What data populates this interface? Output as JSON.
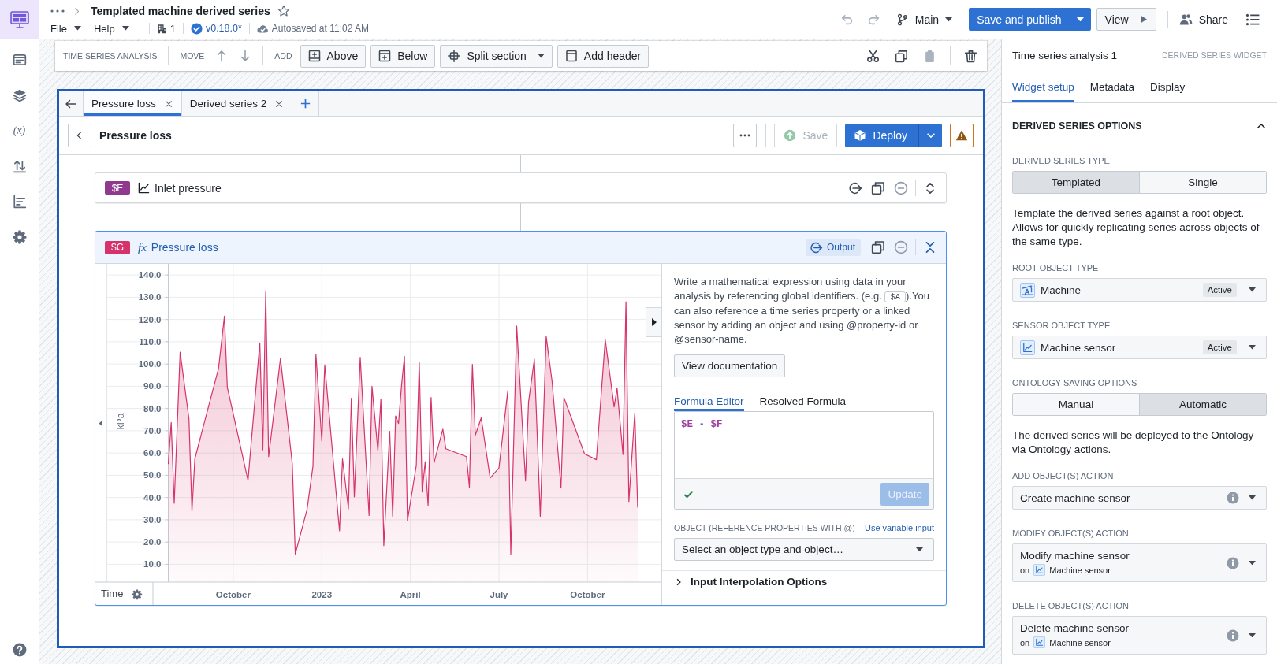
{
  "header": {
    "title": "Templated machine derived series",
    "starred": false,
    "menus": [
      "File",
      "Help"
    ],
    "collaborators": "1",
    "version": "v0.18.0*",
    "autosave": "Autosaved at 11:02 AM",
    "undo_disabled": true,
    "redo_disabled": true,
    "branch": "Main",
    "publish_button": "Save and publish",
    "view_button": "View",
    "share_button": "Share"
  },
  "rail": {
    "variables_label": "(x)"
  },
  "toolbar": {
    "title": "TIME SERIES ANALYSIS",
    "move_label": "MOVE",
    "add_label": "ADD",
    "add_buttons": [
      {
        "kind": "above",
        "label": "Above"
      },
      {
        "kind": "below",
        "label": "Below"
      },
      {
        "kind": "split",
        "label": "Split section"
      },
      {
        "kind": "header",
        "label": "Add header"
      }
    ],
    "paste_disabled": true
  },
  "widget": {
    "tabs": [
      {
        "label": "Pressure loss",
        "selected": true
      },
      {
        "label": "Derived series 2",
        "selected": false
      }
    ],
    "title": "Pressure loss",
    "save_button": {
      "label": "Save",
      "disabled": true
    },
    "deploy_button": "Deploy",
    "warning": true,
    "cards": [
      {
        "kind": "series",
        "badge": "$E",
        "color": "#8f398f",
        "name": "Inlet pressure",
        "selected": false,
        "expanded": false,
        "output": false
      },
      {
        "kind": "formula",
        "badge": "$G",
        "color": "#d6336c",
        "symbol": "fx",
        "name": "Pressure loss",
        "selected": true,
        "expanded": true,
        "output": true,
        "output_label": "Output",
        "chart_data": {
          "type": "area",
          "xlabel": "Time",
          "ylabel": "kPa",
          "grid": true,
          "categories": [
            null,
            null,
            null,
            null,
            null,
            null,
            null,
            null,
            null,
            null,
            null,
            null,
            null,
            null,
            null,
            null,
            null,
            null,
            null,
            null,
            null,
            null,
            "October",
            null,
            null,
            null,
            null,
            null,
            null,
            null,
            null,
            null,
            null,
            null,
            null,
            null,
            null,
            null,
            null,
            null,
            null,
            null,
            null,
            null,
            null,
            null,
            null,
            null,
            null,
            null,
            null,
            null,
            "2023",
            null,
            null,
            null,
            null,
            null,
            null,
            null,
            null,
            null,
            null,
            null,
            null,
            null,
            null,
            null,
            null,
            null,
            null,
            null,
            null,
            null,
            null,
            null,
            null,
            null,
            null,
            null,
            null,
            null,
            "April",
            null,
            null,
            null,
            null,
            null,
            null,
            null,
            null,
            null,
            null,
            null,
            null,
            null,
            null,
            null,
            null,
            null,
            null,
            null,
            null,
            null,
            null,
            null,
            null,
            null,
            null,
            null,
            null,
            null,
            "July",
            null,
            null,
            null,
            null,
            null,
            null,
            null,
            null,
            null,
            null,
            null,
            null,
            null,
            null,
            null,
            null,
            null,
            null,
            null,
            null,
            null,
            null,
            null,
            null,
            null,
            null,
            null,
            null,
            null,
            "October",
            null,
            null,
            null,
            null,
            null,
            null,
            null,
            null,
            null,
            null,
            null,
            null,
            null,
            null,
            null,
            null,
            null,
            null,
            null,
            null,
            null,
            null,
            null,
            null,
            null
          ],
          "series": [
            {
              "color": "#d6336c",
              "values": [
                55,
                73.7,
                37.4,
                null,
                105.3,
                null,
                null,
                75.4,
                33.9,
                57.4,
                null,
                null,
                null,
                null,
                null,
                null,
                null,
                98,
                null,
                121.5,
                89.5,
                null,
                null,
                null,
                null,
                null,
                null,
                47.7,
                null,
                null,
                null,
                109.5,
                61.4,
                132.4,
                58.4,
                null,
                null,
                null,
                102.5,
                null,
                null,
                null,
                55.3,
                14.6,
                null,
                null,
                null,
                34.6,
                null,
                54,
                104.3,
                null,
                65.4,
                99.6,
                null,
                null,
                null,
                null,
                25,
                57.4,
                null,
                35,
                84.6,
                40.3,
                null,
                103,
                null,
                null,
                31.9,
                90,
                null,
                61,
                84.2,
                18.4,
                null,
                69.8,
                31.2,
                76.7,
                73.3,
                90.4,
                103.4,
                29.5,
                null,
                null,
                54.4,
                100.8,
                42.5,
                56.1,
                36.5,
                85,
                55.6,
                null,
                null,
                70.7,
                61.9,
                null,
                null,
                null,
                null,
                null,
                null,
                58.4,
                44.6,
                99.8,
                68,
                null,
                75.8,
                null,
                null,
                48.8,
                null,
                null,
                53.3,
                null,
                null,
                88,
                14.6,
                null,
                117.1,
                null,
                null,
                47.4,
                82.8,
                null,
                102.1,
                null,
                31.6,
                null,
                112.4,
                null,
                92.1,
                null,
                null,
                44.4,
                84.9,
                null,
                null,
                null,
                null,
                null,
                null,
                59.6,
                null,
                null,
                null,
                57,
                null,
                null,
                111,
                null,
                null,
                80.7,
                89.1,
                null,
                59.3,
                128,
                38.2,
                null,
                78,
                35.4,
                null,
                null,
                null,
                null,
                null,
                null,
                null,
                null
              ]
            }
          ],
          "ylim": [
            2,
            145
          ],
          "yticks": [
            {
              "value": 10,
              "label": "10.0"
            },
            {
              "value": 20,
              "label": "20.0"
            },
            {
              "value": 30,
              "label": "30.0"
            },
            {
              "value": 40,
              "label": "40.0"
            },
            {
              "value": 50,
              "label": "50.0"
            },
            {
              "value": 60,
              "label": "60.0"
            },
            {
              "value": 70,
              "label": "70.0"
            },
            {
              "value": 80,
              "label": "80.0"
            },
            {
              "value": 90,
              "label": "90.0"
            },
            {
              "value": 100,
              "label": "100.0"
            },
            {
              "value": 110,
              "label": "110.0"
            },
            {
              "value": 120,
              "label": "120.0"
            },
            {
              "value": 130,
              "label": "130.0"
            },
            {
              "value": 140,
              "label": "140.0"
            }
          ]
        },
        "editor": {
          "help_before": "Write a mathematical expression using data in your analysis by referencing global identifiers. (e.g. ",
          "help_code": "$A",
          "help_after": ").You can also reference a time series property or a linked sensor by adding an object and using @property-id or @sensor-name.",
          "docs_button": "View documentation",
          "tabs": [
            {
              "label": "Formula Editor",
              "selected": true
            },
            {
              "label": "Resolved Formula",
              "selected": false
            }
          ],
          "formula": [
            {
              "kind": "identifier",
              "text": "$E"
            },
            {
              "kind": "operator",
              "text": "-"
            },
            {
              "kind": "identifier",
              "text": "$F"
            }
          ],
          "formula_valid": true,
          "update_button": {
            "label": "Update",
            "disabled": true
          },
          "object_label": "OBJECT (REFERENCE PROPERTIES WITH @)",
          "variable_link": "Use variable input",
          "object_select": {
            "placeholder": "Select an object type and object…"
          },
          "interpolation": {
            "label": "Input Interpolation Options",
            "expanded": false
          }
        }
      }
    ]
  },
  "side_panel": {
    "title": "Time series analysis 1",
    "subtitle": "DERIVED SERIES WIDGET",
    "tabs": [
      {
        "label": "Widget setup",
        "selected": true
      },
      {
        "label": "Metadata",
        "selected": false
      },
      {
        "label": "Display",
        "selected": false
      }
    ],
    "section": {
      "title": "DERIVED SERIES OPTIONS",
      "expanded": true
    },
    "series_type": {
      "label": "DERIVED SERIES TYPE",
      "options": [
        {
          "label": "Templated",
          "selected": true
        },
        {
          "label": "Single",
          "selected": false
        }
      ]
    },
    "series_type_help": "Template the derived series against a root object. Allows for quickly replicating series across objects of the same type.",
    "root_object_type": {
      "label": "ROOT OBJECT TYPE",
      "value": "Machine",
      "status": "Active"
    },
    "sensor_object_type": {
      "label": "SENSOR OBJECT TYPE",
      "value": "Machine sensor",
      "status": "Active"
    },
    "saving_options": {
      "label": "ONTOLOGY SAVING OPTIONS",
      "options": [
        {
          "label": "Manual",
          "selected": false
        },
        {
          "label": "Automatic",
          "selected": true
        }
      ]
    },
    "saving_help": "The derived series will be deployed to the Ontology via Ontology actions.",
    "actions": [
      {
        "label": "ADD OBJECT(S) ACTION",
        "value": "Create machine sensor"
      },
      {
        "label": "MODIFY OBJECT(S) ACTION",
        "value": "Modify machine sensor",
        "target_prefix": "on",
        "target": "Machine sensor"
      },
      {
        "label": "DELETE OBJECT(S) ACTION",
        "value": "Delete machine sensor",
        "target_prefix": "on",
        "target": "Machine sensor"
      }
    ]
  }
}
